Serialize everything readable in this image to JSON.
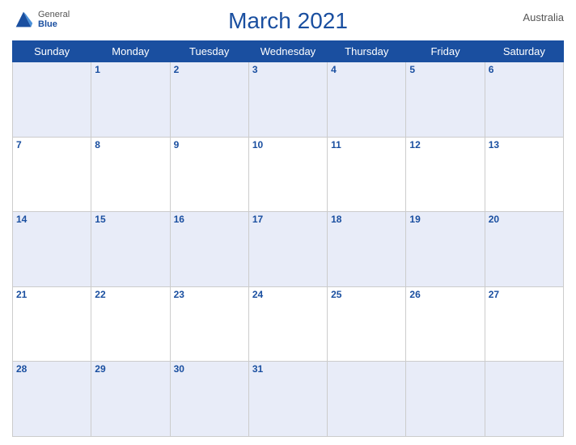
{
  "header": {
    "title": "March 2021",
    "country": "Australia",
    "logo": {
      "general": "General",
      "blue": "Blue"
    }
  },
  "days": [
    "Sunday",
    "Monday",
    "Tuesday",
    "Wednesday",
    "Thursday",
    "Friday",
    "Saturday"
  ],
  "weeks": [
    [
      "",
      "1",
      "2",
      "3",
      "4",
      "5",
      "6"
    ],
    [
      "7",
      "8",
      "9",
      "10",
      "11",
      "12",
      "13"
    ],
    [
      "14",
      "15",
      "16",
      "17",
      "18",
      "19",
      "20"
    ],
    [
      "21",
      "22",
      "23",
      "24",
      "25",
      "26",
      "27"
    ],
    [
      "28",
      "29",
      "30",
      "31",
      "",
      "",
      ""
    ]
  ]
}
